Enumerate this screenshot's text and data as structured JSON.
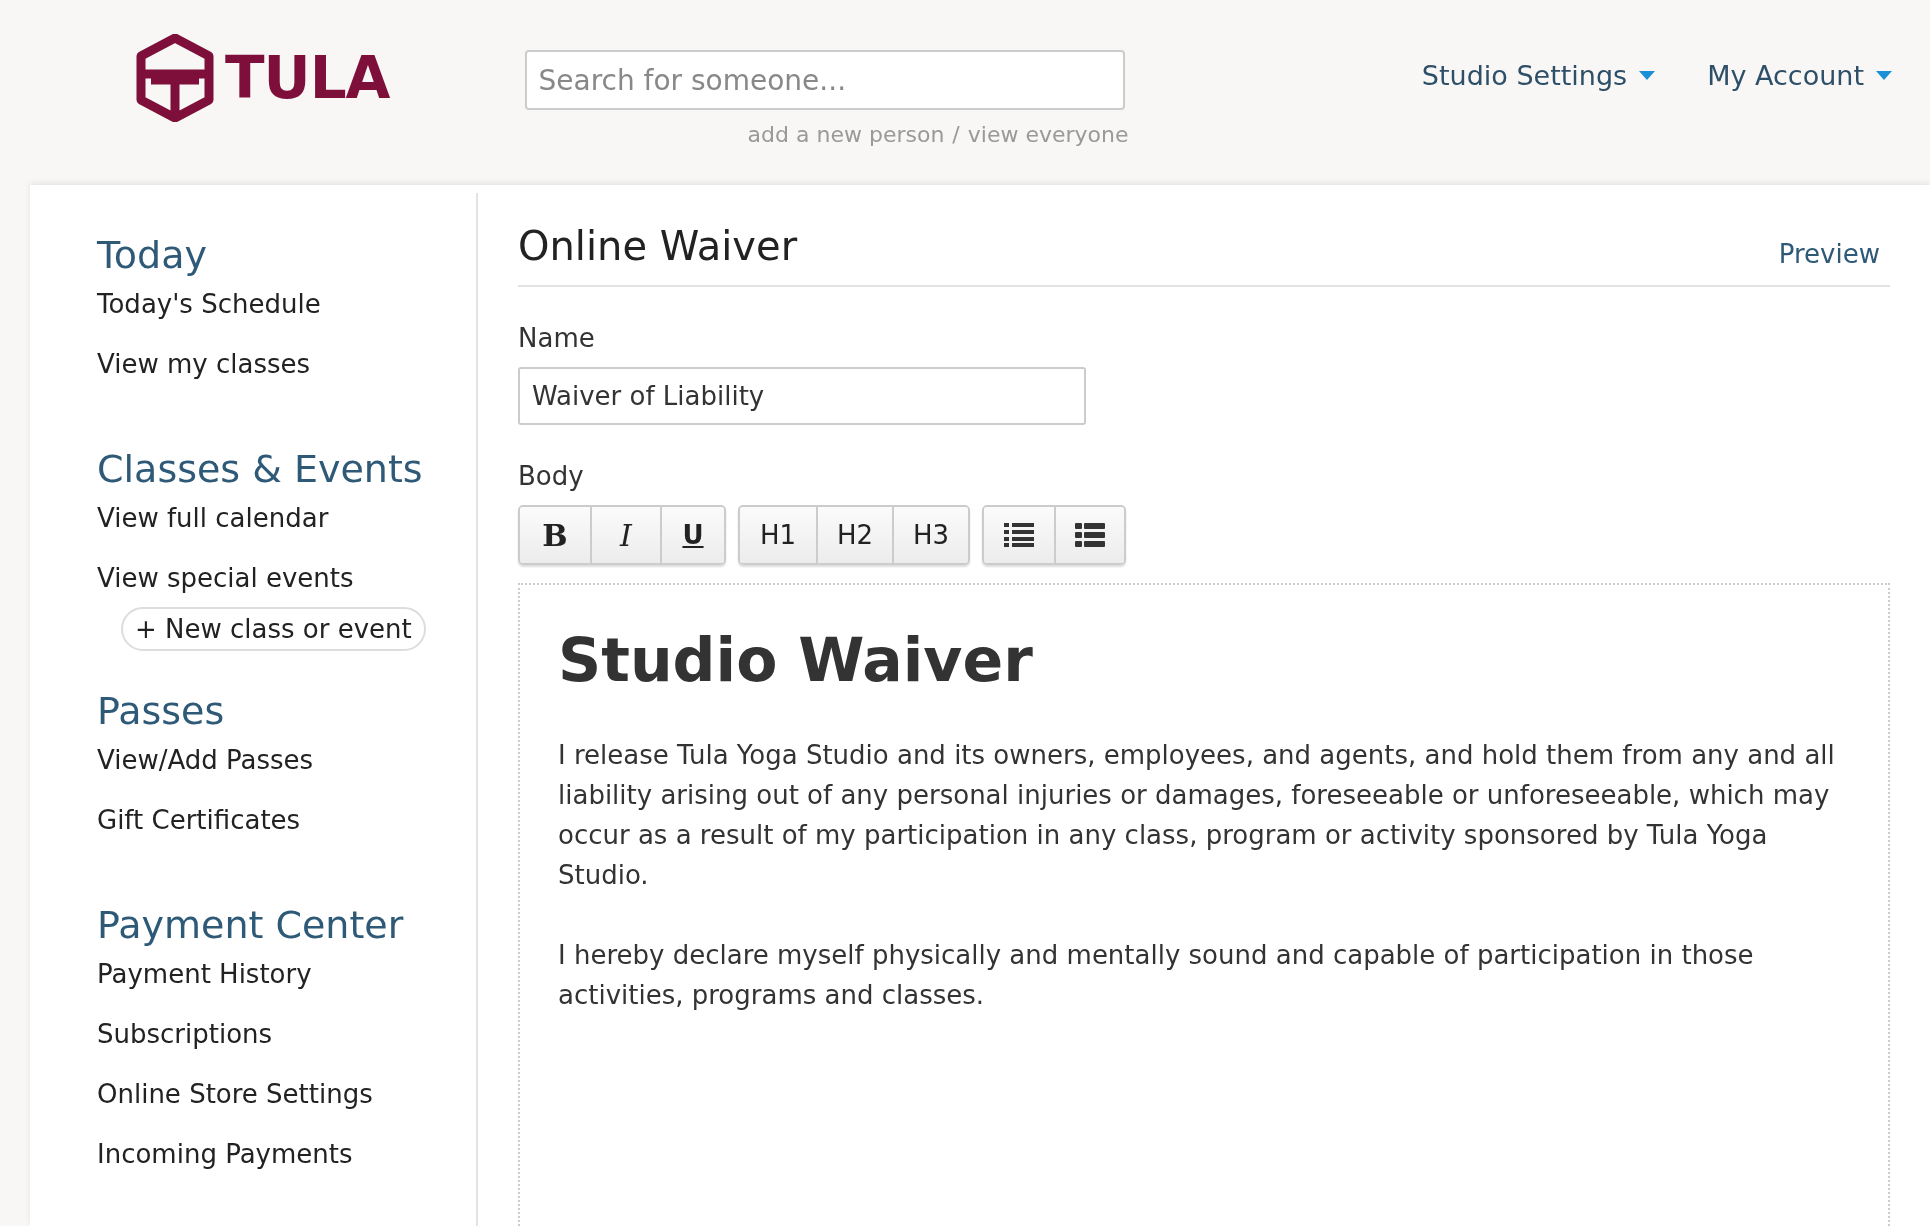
{
  "header": {
    "logo_text": "TULA",
    "search": {
      "placeholder": "Search for someone..."
    },
    "search_links": [
      {
        "label": "add a new person"
      },
      {
        "label": "/"
      },
      {
        "label": "view everyone"
      }
    ],
    "nav": [
      {
        "label": "Studio Settings"
      },
      {
        "label": "My Account"
      }
    ]
  },
  "sidebar": {
    "sections": [
      {
        "title": "Today",
        "items": [
          {
            "label": "Today's Schedule",
            "kind": "link"
          },
          {
            "label": "View my classes",
            "kind": "link"
          }
        ]
      },
      {
        "title": "Classes & Events",
        "items": [
          {
            "label": "View full calendar",
            "kind": "link"
          },
          {
            "label": "View special events",
            "kind": "link"
          },
          {
            "label": "+ New class or event",
            "kind": "button"
          }
        ]
      },
      {
        "title": "Passes",
        "items": [
          {
            "label": "View/Add Passes",
            "kind": "link"
          },
          {
            "label": "Gift Certificates",
            "kind": "link"
          }
        ]
      },
      {
        "title": "Payment Center",
        "items": [
          {
            "label": "Payment History",
            "kind": "link"
          },
          {
            "label": "Subscriptions",
            "kind": "link"
          },
          {
            "label": "Online Store Settings",
            "kind": "link"
          },
          {
            "label": "Incoming Payments",
            "kind": "link"
          }
        ]
      }
    ]
  },
  "page": {
    "title": "Online Waiver",
    "preview_link": "Preview",
    "name_label": "Name",
    "name_value": "Waiver of Liability",
    "body_label": "Body",
    "toolbar": [
      [
        {
          "kind": "bold",
          "label": "B"
        },
        {
          "kind": "italic",
          "label": "I"
        },
        {
          "kind": "underline",
          "label": "U"
        }
      ],
      [
        {
          "kind": "heading",
          "label": "H1"
        },
        {
          "kind": "heading",
          "label": "H2"
        },
        {
          "kind": "heading",
          "label": "H3"
        }
      ],
      [
        {
          "kind": "list"
        },
        {
          "kind": "block-list"
        }
      ]
    ],
    "body": {
      "heading": "Studio Waiver",
      "paragraphs": [
        "I release Tula Yoga Studio and its owners, employees, and agents, and hold them from any and all liability arising out of any personal injuries or damages, foreseeable or unforeseeable, which may occur as a result of my participation in any class, program or activity sponsored by Tula Yoga Studio.",
        "I hereby declare myself physically and mentally sound and capable of participation in those activities, programs and classes."
      ]
    }
  }
}
